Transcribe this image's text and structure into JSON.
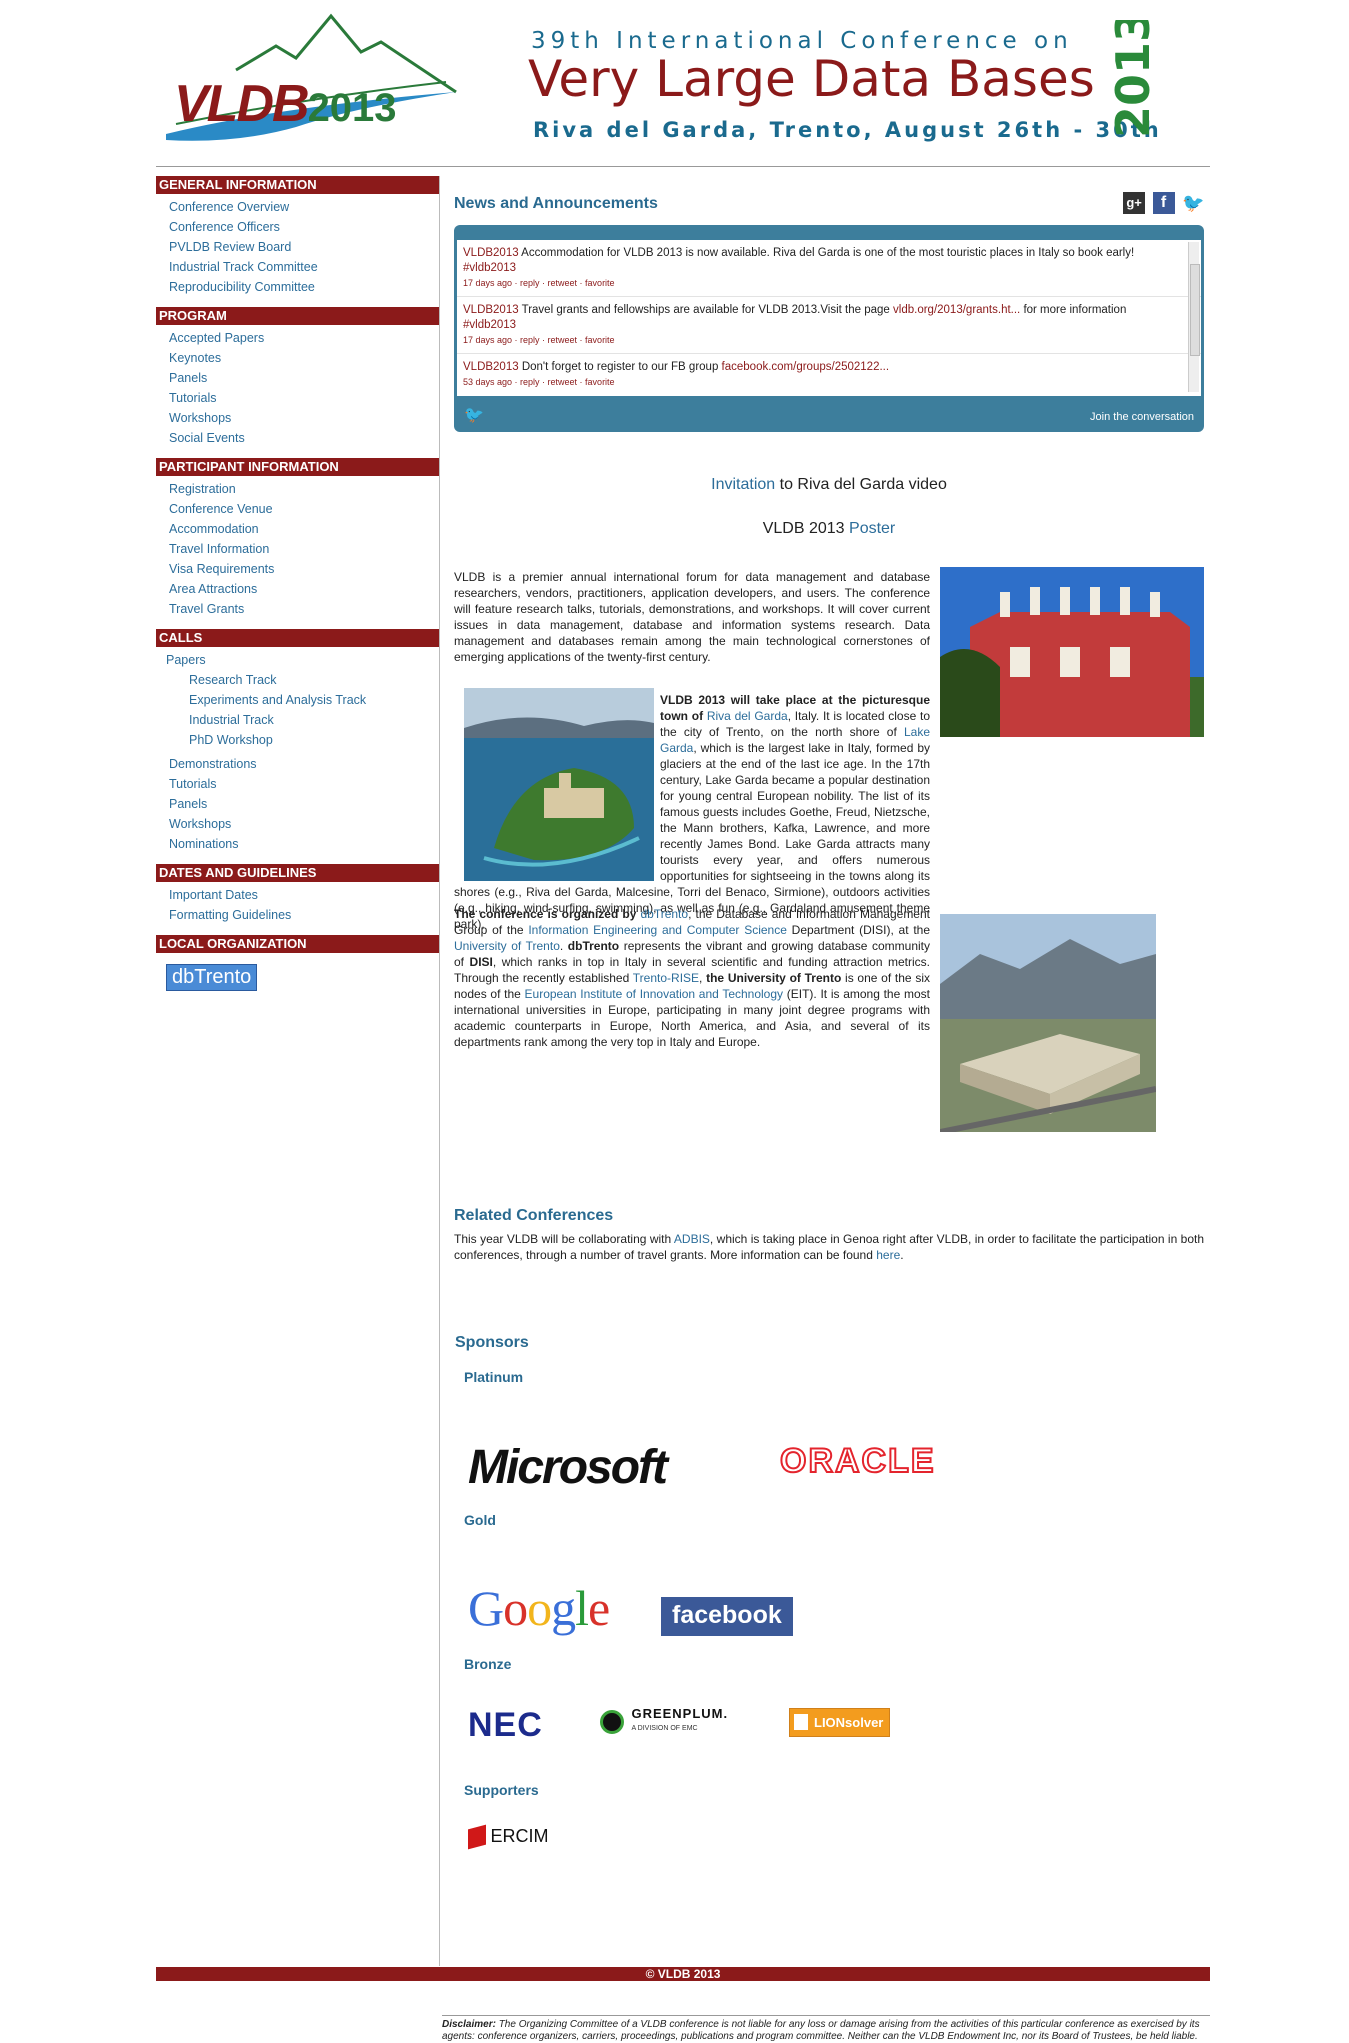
{
  "header": {
    "logo_text": "VLDB",
    "logo_year": "2013",
    "line1": "39th International Conference on",
    "line2": "Very Large Data Bases",
    "line3": "Riva del Garda, Trento, August 26th - 30th",
    "year_vertical": "2013"
  },
  "sidebar": {
    "general": {
      "title": "GENERAL INFORMATION",
      "items": [
        "Conference Overview",
        "Conference Officers",
        "PVLDB Review Board",
        "Industrial Track Committee",
        "Reproducibility Committee"
      ]
    },
    "program": {
      "title": "PROGRAM",
      "items": [
        "Accepted Papers",
        "Keynotes",
        "Panels",
        "Tutorials",
        "Workshops",
        "Social Events"
      ]
    },
    "participant": {
      "title": "PARTICIPANT INFORMATION",
      "items": [
        "Registration",
        "Conference Venue",
        "Accommodation",
        "Travel Information",
        "Visa Requirements",
        "Area Attractions",
        "Travel Grants"
      ]
    },
    "calls": {
      "title": "CALLS",
      "papers": "Papers",
      "paper_sub": [
        "Research Track",
        "Experiments and Analysis Track",
        "Industrial Track",
        "PhD Workshop"
      ],
      "items": [
        "Demonstrations",
        "Tutorials",
        "Panels",
        "Workshops",
        "Nominations"
      ]
    },
    "dates": {
      "title": "DATES AND GUIDELINES",
      "items": [
        "Important Dates",
        "Formatting Guidelines"
      ]
    },
    "local": {
      "title": "LOCAL ORGANIZATION",
      "badge": "dbTrento"
    }
  },
  "news": {
    "title": "News and Announcements",
    "tweets": [
      {
        "user": "VLDB2013",
        "text": " Accommodation for VLDB 2013 is now available. Riva del Garda is one of the most touristic places in Italy so book early! ",
        "tag": "#vldb2013",
        "meta": "17 days ago · reply · retweet · favorite"
      },
      {
        "user": "VLDB2013",
        "text": " Travel grants and fellowships are available for VLDB 2013.Visit the page ",
        "link": "vldb.org/2013/grants.ht...",
        "text2": " for more information ",
        "tag": "#vldb2013",
        "meta": "17 days ago · reply · retweet · favorite"
      },
      {
        "user": "VLDB2013",
        "text": " Don't forget to register to our FB group ",
        "link": "facebook.com/groups/2502122...",
        "meta": "53 days ago · reply · retweet · favorite"
      }
    ],
    "join": "Join the conversation"
  },
  "invitation": {
    "link": "Invitation",
    "rest": " to Riva del Garda video"
  },
  "poster": {
    "text": "VLDB 2013 ",
    "link": "Poster"
  },
  "intro": "VLDB is a premier annual international forum for data management and database researchers, vendors, practitioners, application developers, and users. The conference will feature research talks, tutorials, demonstrations, and workshops. It will cover current issues in data management, database and information systems research. Data management and databases remain among the main technological cornerstones of emerging applications of the twenty-first century.",
  "venue": {
    "bold": "VLDB 2013 will take place at the picturesque town of ",
    "link1": "Riva del Garda",
    "t1": ", Italy. It is located close to the city of Trento, on the north shore of ",
    "link2": "Lake Garda",
    "t2": ", which is the largest lake in Italy, formed by glaciers at the end of the last ice age. In the 17th century, Lake Garda became a popular destination for young central European nobility. The list of its famous guests includes Goethe, Freud, Nietzsche, the Mann brothers, Kafka, Lawrence, and more recently James Bond. Lake Garda attracts many tourists every year, and offers numerous opportunities for sightseeing in the towns along its shores (e.g., Riva del Garda, Malcesine, Torri del Benaco, Sirmione), outdoors activities (e.g., hiking, wind-surfing, swimming), as well as fun (e.g., Gardaland amusement theme park)."
  },
  "org": {
    "bold1": "The conference is organized by ",
    "link1": "dbTrento",
    "t1": ", the Database and Information Management Group of the ",
    "link2": "Information Engineering and Computer Science",
    "t2": " Department (DISI), at the ",
    "link3": "University of Trento",
    "t3": ". ",
    "bold2": "dbTrento",
    "t4": " represents the vibrant and growing database community of ",
    "bold3": "DISI",
    "t5": ", which ranks in top in Italy in several scientific and funding attraction metrics. Through the recently established ",
    "link4": "Trento-RISE",
    "t6": ", ",
    "bold4": "the University of Trento",
    "t7": " is one of the six nodes of the ",
    "link5": "European Institute of Innovation and Technology",
    "t8": " (EIT). It is among the most international universities in Europe, participating in many joint degree programs with academic counterparts in Europe, North America, and Asia, and several of its departments rank among the very top in Italy and Europe."
  },
  "related": {
    "title": "Related Conferences",
    "t1": "This year VLDB will be collaborating with ",
    "link1": "ADBIS",
    "t2": ", which is taking place in Genoa right after VLDB, in order to facilitate the participation in both conferences, through a number of travel grants. More information can be found ",
    "link2": "here",
    "t3": "."
  },
  "sponsors": {
    "title": "Sponsors",
    "platinum": "Platinum",
    "gold": "Gold",
    "bronze": "Bronze",
    "supporters": "Supporters",
    "logos": {
      "microsoft": "Microsoft",
      "oracle": "ORACLE",
      "google": "Google",
      "facebook": "facebook",
      "nec": "NEC",
      "greenplum": "GREENPLUM.",
      "greenplum_sub": "A DIVISION OF EMC",
      "lionsolver": "LIONsolver",
      "ercim": "ERCIM"
    }
  },
  "footer": {
    "copyright": "© VLDB 2013",
    "disclaimer_label": "Disclaimer:",
    "disclaimer": " The Organizing Committee of a VLDB conference is not liable for any loss or damage arising from the activities of this particular conference as exercised by its agents: conference organizers, carriers, proceedings, publications and program committee. Neither can the VLDB Endowment Inc, nor its Board of Trustees, be held liable."
  },
  "colors": {
    "maroon": "#8b1a1a",
    "link": "#2c6d9a",
    "twitter_frame": "#3d7e9c"
  }
}
